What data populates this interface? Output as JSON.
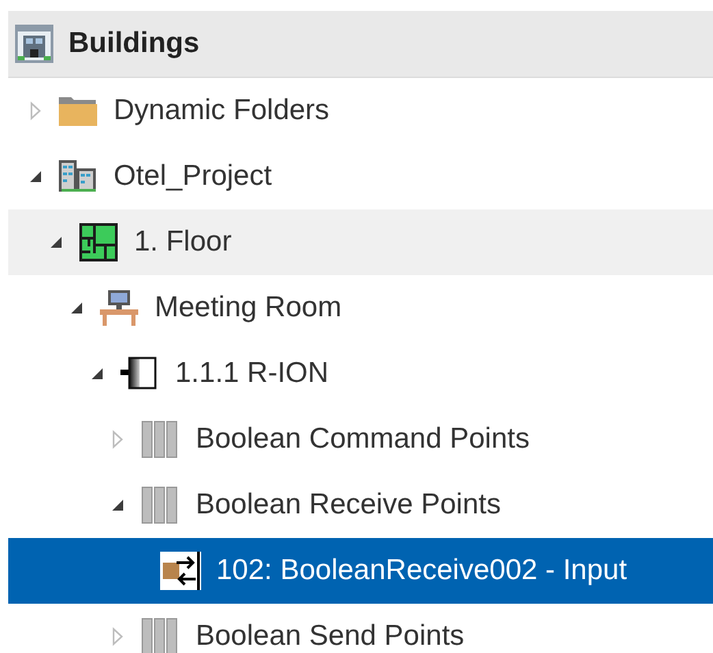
{
  "header": {
    "title": "Buildings"
  },
  "tree": [
    {
      "kind": "folder",
      "label": "Dynamic Folders",
      "expanded": false,
      "selected": false,
      "hovered": false
    },
    {
      "kind": "project",
      "label": "Otel_Project",
      "expanded": true,
      "selected": false,
      "hovered": false,
      "children": [
        {
          "kind": "floor",
          "label": "1. Floor",
          "expanded": true,
          "selected": false,
          "hovered": true,
          "children": [
            {
              "kind": "room",
              "label": "Meeting Room",
              "expanded": true,
              "selected": false,
              "hovered": false,
              "children": [
                {
                  "kind": "device",
                  "label": "1.1.1 R-ION",
                  "expanded": true,
                  "selected": false,
                  "hovered": false,
                  "children": [
                    {
                      "kind": "group",
                      "label": "Boolean Command Points",
                      "expanded": false,
                      "selected": false,
                      "hovered": false
                    },
                    {
                      "kind": "group",
                      "label": "Boolean Receive Points",
                      "expanded": true,
                      "selected": false,
                      "hovered": false,
                      "children": [
                        {
                          "kind": "point",
                          "label": "102: BooleanReceive002 - Input",
                          "selected": true,
                          "hovered": false
                        }
                      ]
                    },
                    {
                      "kind": "group",
                      "label": "Boolean Send Points",
                      "expanded": false,
                      "selected": false,
                      "hovered": false
                    }
                  ]
                }
              ]
            }
          ]
        }
      ]
    }
  ]
}
